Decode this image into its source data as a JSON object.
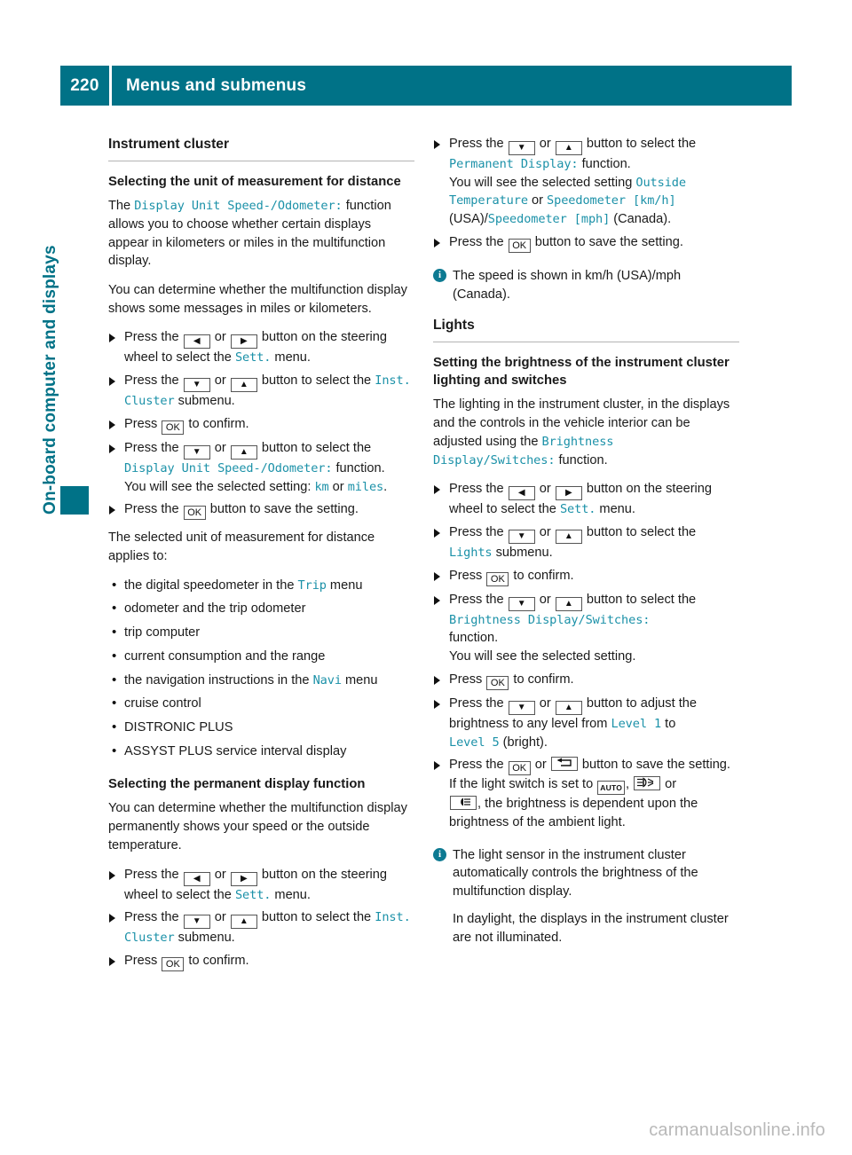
{
  "header": {
    "page_number": "220",
    "title": "Menus and submenus",
    "band_color": "#007287"
  },
  "chapter_tab": {
    "label": "On-board computer and displays",
    "color": "#007287"
  },
  "icons": {
    "left_arrow": "◀",
    "right_arrow": "▶",
    "down_arrow": "▼",
    "up_arrow": "▲",
    "ok": "OK",
    "auto": "AUTO",
    "info": "i"
  },
  "left_column": {
    "section_heading": "Instrument cluster",
    "sub1": {
      "heading": "Selecting the unit of measurement for distance",
      "p1_a": "The ",
      "p1_ui": "Display Unit Speed-/Odometer:",
      "p1_b": " function allows you to choose whether certain displays appear in kilometers or miles in the multifunction display.",
      "p2": "You can determine whether the multifunction display shows some messages in miles or kilometers.",
      "steps": [
        {
          "a": "Press the ",
          "k1": "left_arrow",
          "mid": " or ",
          "k2": "right_arrow",
          "b": " button on the steering wheel to select the ",
          "ui": "Sett.",
          "c": " menu."
        },
        {
          "a": "Press the ",
          "k1": "down_arrow",
          "mid": " or ",
          "k2": "up_arrow",
          "b": " button to select the ",
          "ui": "Inst. Cluster",
          "c": " submenu."
        },
        {
          "a": "Press ",
          "k1": "ok",
          "b": " to confirm."
        },
        {
          "a": "Press the ",
          "k1": "down_arrow",
          "mid": " or ",
          "k2": "up_arrow",
          "b": " button to select the ",
          "ui": "Display Unit Speed-/Odometer:",
          "c": " function.",
          "line2_a": "You will see the selected setting: ",
          "line2_ui1": "km",
          "line2_mid": " or ",
          "line2_ui2": "miles",
          "line2_b": "."
        },
        {
          "a": "Press the ",
          "k1": "ok",
          "b": " button to save the setting."
        }
      ],
      "p3": "The selected unit of measurement for distance applies to:",
      "applies_to": [
        {
          "a": "the digital speedometer in the ",
          "ui": "Trip",
          "b": " menu"
        },
        {
          "a": "odometer and the trip odometer"
        },
        {
          "a": "trip computer"
        },
        {
          "a": "current consumption and the range"
        },
        {
          "a": "the navigation instructions in the ",
          "ui": "Navi",
          "b": " menu"
        },
        {
          "a": "cruise control"
        },
        {
          "a": "DISTRONIC PLUS"
        },
        {
          "a": "ASSYST PLUS service interval display"
        }
      ]
    },
    "sub2": {
      "heading": "Selecting the permanent display function",
      "p1": "You can determine whether the multifunction display permanently shows your speed or the outside temperature.",
      "steps": [
        {
          "a": "Press the ",
          "k1": "left_arrow",
          "mid": " or ",
          "k2": "right_arrow",
          "b": " button on the steering wheel to select the ",
          "ui": "Sett.",
          "c": " menu."
        },
        {
          "a": "Press the ",
          "k1": "down_arrow",
          "mid": " or ",
          "k2": "up_arrow",
          "b": " button to select the ",
          "ui": "Inst. Cluster",
          "c": " submenu."
        },
        {
          "a": "Press ",
          "k1": "ok",
          "b": " to confirm."
        }
      ]
    }
  },
  "right_column": {
    "continued_steps": [
      {
        "a": "Press the ",
        "k1": "down_arrow",
        "mid": " or ",
        "k2": "up_arrow",
        "b": " button to select the ",
        "ui": "Permanent Display:",
        "c": " function.",
        "line2_a": "You will see the selected setting ",
        "line2_ui1": "Outside Temperature",
        "line2_mid": " or ",
        "line2_ui2": "Speedometer [km/h]",
        "line2_b": " (USA)/",
        "line2_ui3": "Speedometer [mph]",
        "line2_c": " (Canada)."
      },
      {
        "a": "Press the ",
        "k1": "ok",
        "b": " button to save the setting."
      }
    ],
    "note1": "The speed is shown in km/h (USA)/mph (Canada).",
    "section_heading": "Lights",
    "sub1": {
      "heading": "Setting the brightness of the instrument cluster lighting and switches",
      "p1_a": "The lighting in the instrument cluster, in the displays and the controls in the vehicle interior can be adjusted using the ",
      "p1_ui": "Brightness Display/Switches:",
      "p1_b": " function.",
      "steps": [
        {
          "a": "Press the ",
          "k1": "left_arrow",
          "mid": " or ",
          "k2": "right_arrow",
          "b": " button on the steering wheel to select the ",
          "ui": "Sett.",
          "c": " menu."
        },
        {
          "a": "Press the ",
          "k1": "down_arrow",
          "mid": " or ",
          "k2": "up_arrow",
          "b": " button to select the ",
          "ui": "Lights",
          "c": " submenu."
        },
        {
          "a": "Press ",
          "k1": "ok",
          "b": " to confirm."
        },
        {
          "a": "Press the ",
          "k1": "down_arrow",
          "mid": " or ",
          "k2": "up_arrow",
          "b": " button to select the ",
          "ui": "Brightness Display/Switches:",
          "c": " function.",
          "line2_a": "You will see the selected setting."
        },
        {
          "a": "Press ",
          "k1": "ok",
          "b": " to confirm."
        },
        {
          "a": "Press the ",
          "k1": "down_arrow",
          "mid": " or ",
          "k2": "up_arrow",
          "b": " button to adjust the brightness to any level from ",
          "ui": "Level 1",
          "c": " to ",
          "ui2": "Level 5",
          "d": " (bright)."
        },
        {
          "a": "Press the ",
          "k1": "ok",
          "mid": " or ",
          "k2": "back",
          "b": " button to save the setting.",
          "line2_a": "If the light switch is set to ",
          "line2_k1": "auto",
          "line2_mid": ", ",
          "line2_k2": "headlight",
          "line2_mid2": " or ",
          "line2_k3": "lowbeam",
          "line2_b": ", the brightness is dependent upon the brightness of the ambient light."
        }
      ],
      "note_p1": "The light sensor in the instrument cluster automatically controls the brightness of the multifunction display.",
      "note_p2": "In daylight, the displays in the instrument cluster are not illuminated."
    }
  },
  "footer": {
    "watermark": "carmanualsonline.info"
  }
}
